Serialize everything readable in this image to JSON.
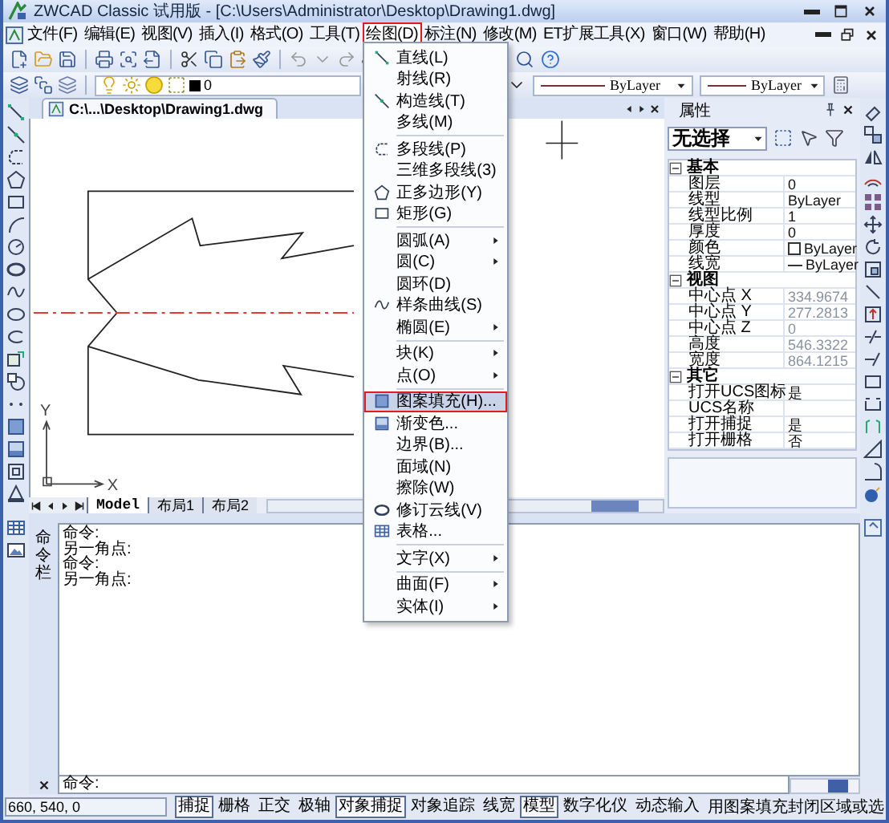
{
  "window": {
    "title": "ZWCAD Classic 试用版 - [C:\\Users\\Administrator\\Desktop\\Drawing1.dwg]"
  },
  "menu_bar": [
    {
      "label": "文件(F)",
      "selected": false
    },
    {
      "label": "编辑(E)",
      "selected": false
    },
    {
      "label": "视图(V)",
      "selected": false
    },
    {
      "label": "插入(I)",
      "selected": false
    },
    {
      "label": "格式(O)",
      "selected": false
    },
    {
      "label": "工具(T)",
      "selected": false
    },
    {
      "label": "绘图(D)",
      "selected": true
    },
    {
      "label": "标注(N)",
      "selected": false
    },
    {
      "label": "修改(M)",
      "selected": false
    },
    {
      "label": "ET扩展工具(X)",
      "selected": false
    },
    {
      "label": "窗口(W)",
      "selected": false
    },
    {
      "label": "帮助(H)",
      "selected": false
    }
  ],
  "layer_toolbar": {
    "layer": "0",
    "linetype": "ByLayer",
    "lineweight": "ByLayer"
  },
  "document_tab": {
    "label": "C:\\...\\Desktop\\Drawing1.dwg"
  },
  "ucs_icon": {
    "x_label": "X",
    "y_label": "Y"
  },
  "layout_tabs": [
    {
      "label": "Model",
      "selected": true
    },
    {
      "label": "布局1",
      "selected": false
    },
    {
      "label": "布局2",
      "selected": false
    }
  ],
  "draw_menu": [
    {
      "label": "直线(L)",
      "separator_before": false,
      "submenu": false,
      "selected": false
    },
    {
      "label": "射线(R)",
      "separator_before": false,
      "submenu": false,
      "selected": false
    },
    {
      "label": "构造线(T)",
      "separator_before": false,
      "submenu": false,
      "selected": false
    },
    {
      "label": "多线(M)",
      "separator_before": false,
      "submenu": false,
      "selected": false
    },
    {
      "label": "多段线(P)",
      "separator_before": true,
      "submenu": false,
      "selected": false
    },
    {
      "label": "三维多段线(3)",
      "separator_before": false,
      "submenu": false,
      "selected": false
    },
    {
      "label": "正多边形(Y)",
      "separator_before": false,
      "submenu": false,
      "selected": false
    },
    {
      "label": "矩形(G)",
      "separator_before": false,
      "submenu": false,
      "selected": false
    },
    {
      "label": "圆弧(A)",
      "separator_before": true,
      "submenu": true,
      "selected": false
    },
    {
      "label": "圆(C)",
      "separator_before": false,
      "submenu": true,
      "selected": false
    },
    {
      "label": "圆环(D)",
      "separator_before": false,
      "submenu": false,
      "selected": false
    },
    {
      "label": "样条曲线(S)",
      "separator_before": false,
      "submenu": false,
      "selected": false
    },
    {
      "label": "椭圆(E)",
      "separator_before": false,
      "submenu": true,
      "selected": false
    },
    {
      "label": "块(K)",
      "separator_before": true,
      "submenu": true,
      "selected": false
    },
    {
      "label": "点(O)",
      "separator_before": false,
      "submenu": true,
      "selected": false
    },
    {
      "label": "图案填充(H)...",
      "separator_before": true,
      "submenu": false,
      "selected": true
    },
    {
      "label": "渐变色...",
      "separator_before": false,
      "submenu": false,
      "selected": false
    },
    {
      "label": "边界(B)...",
      "separator_before": false,
      "submenu": false,
      "selected": false
    },
    {
      "label": "面域(N)",
      "separator_before": false,
      "submenu": false,
      "selected": false
    },
    {
      "label": "擦除(W)",
      "separator_before": false,
      "submenu": false,
      "selected": false
    },
    {
      "label": "修订云线(V)",
      "separator_before": false,
      "submenu": false,
      "selected": false
    },
    {
      "label": "表格...",
      "separator_before": false,
      "submenu": false,
      "selected": false
    },
    {
      "label": "文字(X)",
      "separator_before": true,
      "submenu": true,
      "selected": false
    },
    {
      "label": "曲面(F)",
      "separator_before": true,
      "submenu": true,
      "selected": false
    },
    {
      "label": "实体(I)",
      "separator_before": false,
      "submenu": true,
      "selected": false
    }
  ],
  "properties": {
    "title": "属性",
    "selection": "无选择",
    "groups": [
      {
        "name": "基本",
        "expanded": true,
        "rows": [
          {
            "label": "图层",
            "value": "0",
            "kind": "text",
            "disabled": false
          },
          {
            "label": "线型",
            "value": "ByLayer",
            "kind": "text",
            "disabled": false
          },
          {
            "label": "线型比例",
            "value": "1",
            "kind": "text",
            "disabled": false
          },
          {
            "label": "厚度",
            "value": "0",
            "kind": "text",
            "disabled": false
          },
          {
            "label": "颜色",
            "value": "ByLayer",
            "kind": "color",
            "disabled": false
          },
          {
            "label": "线宽",
            "value": "ByLayer",
            "kind": "lineweight",
            "disabled": false
          }
        ]
      },
      {
        "name": "视图",
        "expanded": true,
        "rows": [
          {
            "label": "中心点 X",
            "value": "334.9674",
            "kind": "text",
            "disabled": true
          },
          {
            "label": "中心点 Y",
            "value": "277.2813",
            "kind": "text",
            "disabled": true
          },
          {
            "label": "中心点 Z",
            "value": "0",
            "kind": "text",
            "disabled": true
          },
          {
            "label": "高度",
            "value": "546.3322",
            "kind": "text",
            "disabled": true
          },
          {
            "label": "宽度",
            "value": "864.1215",
            "kind": "text",
            "disabled": true
          }
        ]
      },
      {
        "name": "其它",
        "expanded": true,
        "rows": [
          {
            "label": "打开UCS图标",
            "value": "是",
            "kind": "text",
            "disabled": false
          },
          {
            "label": "UCS名称"
          },
          {
            "label": "打开捕捉",
            "value": "是",
            "kind": "text",
            "disabled": false
          },
          {
            "label": "打开栅格",
            "value": "否",
            "kind": "text",
            "disabled": false
          }
        ]
      }
    ]
  },
  "command_window": {
    "title": "命令栏",
    "history": [
      "命令:",
      "另一角点:",
      "命令:",
      "另一角点:"
    ],
    "prompt": "命令:"
  },
  "status_bar": {
    "coordinates": "660,  540,  0",
    "toggles": [
      {
        "label": "捕捉",
        "on": true
      },
      {
        "label": "栅格",
        "on": false
      },
      {
        "label": "正交",
        "on": false
      },
      {
        "label": "极轴",
        "on": false
      },
      {
        "label": "对象捕捉",
        "on": true
      },
      {
        "label": "对象追踪",
        "on": false
      },
      {
        "label": "线宽",
        "on": false
      },
      {
        "label": "模型",
        "on": true
      },
      {
        "label": "数字化仪",
        "on": false
      },
      {
        "label": "动态输入",
        "on": false
      }
    ],
    "message": "用图案填充封闭区域或选"
  }
}
